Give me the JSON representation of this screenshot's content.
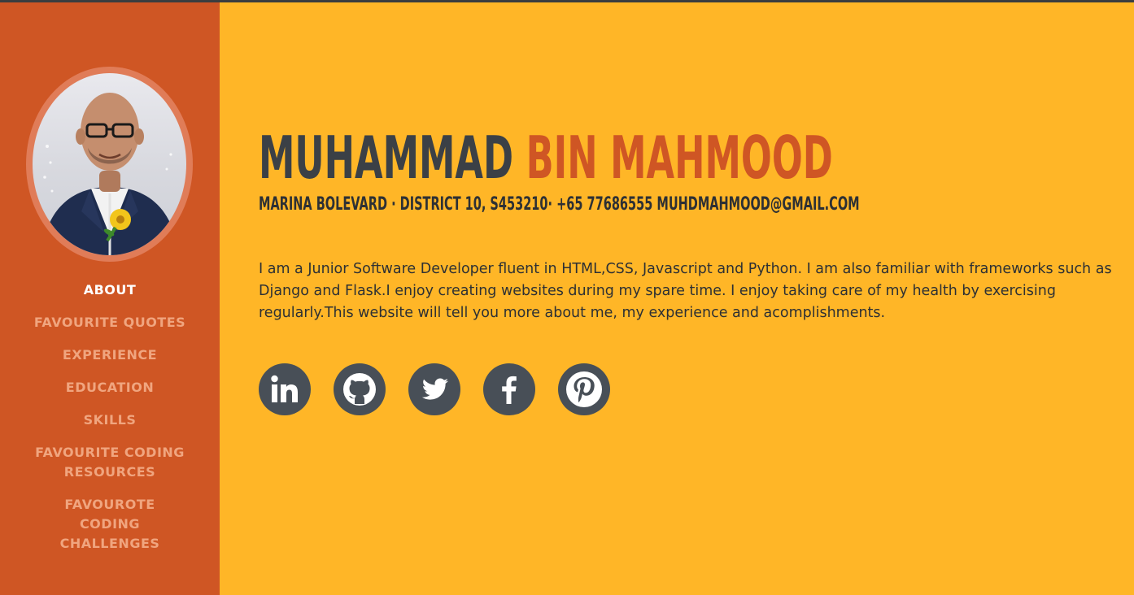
{
  "profile": {
    "first_name": "MUHAMMAD",
    "last_name": "BIN MAHMOOD",
    "contact": "MARINA BOLEVARD · DISTRICT 10, S453210· +65 77686555 MUHDMAHMOOD@GMAIL.COM",
    "bio": "I am a Junior Software Developer fluent in HTML,CSS, Javascript and Python. I am also familiar with frameworks such as Django and Flask.I enjoy creating websites during my spare time. I enjoy taking care of my health by exercising regularly.This website will tell you more about me, my experience and acomplishments."
  },
  "nav": {
    "items": [
      {
        "label": "ABOUT",
        "active": true
      },
      {
        "label": "FAVOURITE QUOTES"
      },
      {
        "label": "EXPERIENCE"
      },
      {
        "label": "EDUCATION"
      },
      {
        "label": "SKILLS"
      },
      {
        "label": "FAVOURITE CODING RESOURCES"
      },
      {
        "label": "FAVOUROTE CODING CHALLENGES"
      }
    ]
  },
  "socials": [
    {
      "icon": "linkedin-icon"
    },
    {
      "icon": "github-icon"
    },
    {
      "icon": "twitter-icon"
    },
    {
      "icon": "facebook-icon"
    },
    {
      "icon": "pinterest-icon"
    }
  ],
  "colors": {
    "sidebar": "#cf5624",
    "background": "#ffb627",
    "name_dark": "#3b4046",
    "name_accent": "#cf5624",
    "social_circle": "#484f57",
    "nav_inactive": "#f0a57f",
    "nav_active": "#ffffff"
  }
}
